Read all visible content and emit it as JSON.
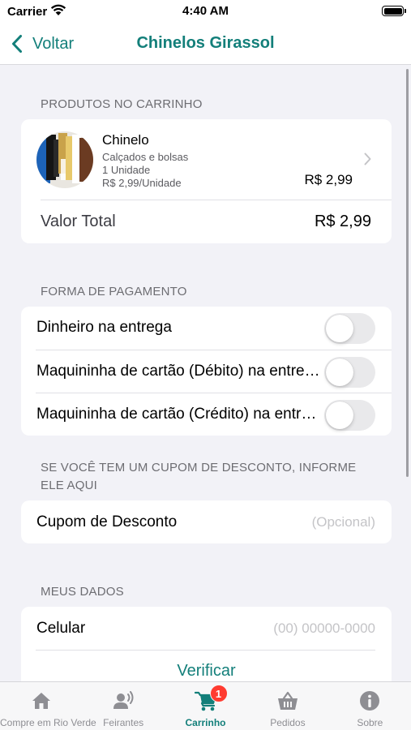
{
  "status_bar": {
    "carrier": "Carrier",
    "time": "4:40 AM"
  },
  "nav": {
    "back_label": "Voltar",
    "title": "Chinelos Girassol"
  },
  "cart": {
    "header": "PRODUTOS NO CARRINHO",
    "items": [
      {
        "name": "Chinelo",
        "category": "Calçados e bolsas",
        "quantity": "1 Unidade",
        "unit_price": "R$ 2,99/Unidade",
        "price": "R$ 2,99"
      }
    ],
    "total_label": "Valor Total",
    "total_value": "R$ 2,99"
  },
  "payment": {
    "header": "FORMA DE PAGAMENTO",
    "options": [
      {
        "label": "Dinheiro na entrega",
        "enabled": false
      },
      {
        "label": "Maquininha de cartão (Débito) na entrega",
        "enabled": false
      },
      {
        "label": "Maquininha de cartão (Crédito) na entrega",
        "enabled": false
      }
    ]
  },
  "coupon": {
    "header": "SE VOCÊ TEM UM CUPOM DE DESCONTO, INFORME ELE AQUI",
    "label": "Cupom de Desconto",
    "placeholder": "(Opcional)"
  },
  "my_data": {
    "header": "MEUS DADOS",
    "phone_label": "Celular",
    "phone_placeholder": "(00) 00000-0000",
    "verify_label": "Verificar"
  },
  "tab_bar": {
    "tabs": [
      {
        "label": "Compre em Rio Verde",
        "icon": "home-icon",
        "active": false
      },
      {
        "label": "Feirantes",
        "icon": "vendor-icon",
        "active": false
      },
      {
        "label": "Carrinho",
        "icon": "cart-icon",
        "active": true,
        "badge": "1"
      },
      {
        "label": "Pedidos",
        "icon": "basket-icon",
        "active": false
      },
      {
        "label": "Sobre",
        "icon": "info-icon",
        "active": false
      }
    ]
  },
  "colors": {
    "accent": "#137f7a",
    "background": "#f2f2f7",
    "badge": "#ff3b30",
    "inactive_tab": "#8e8e93"
  }
}
